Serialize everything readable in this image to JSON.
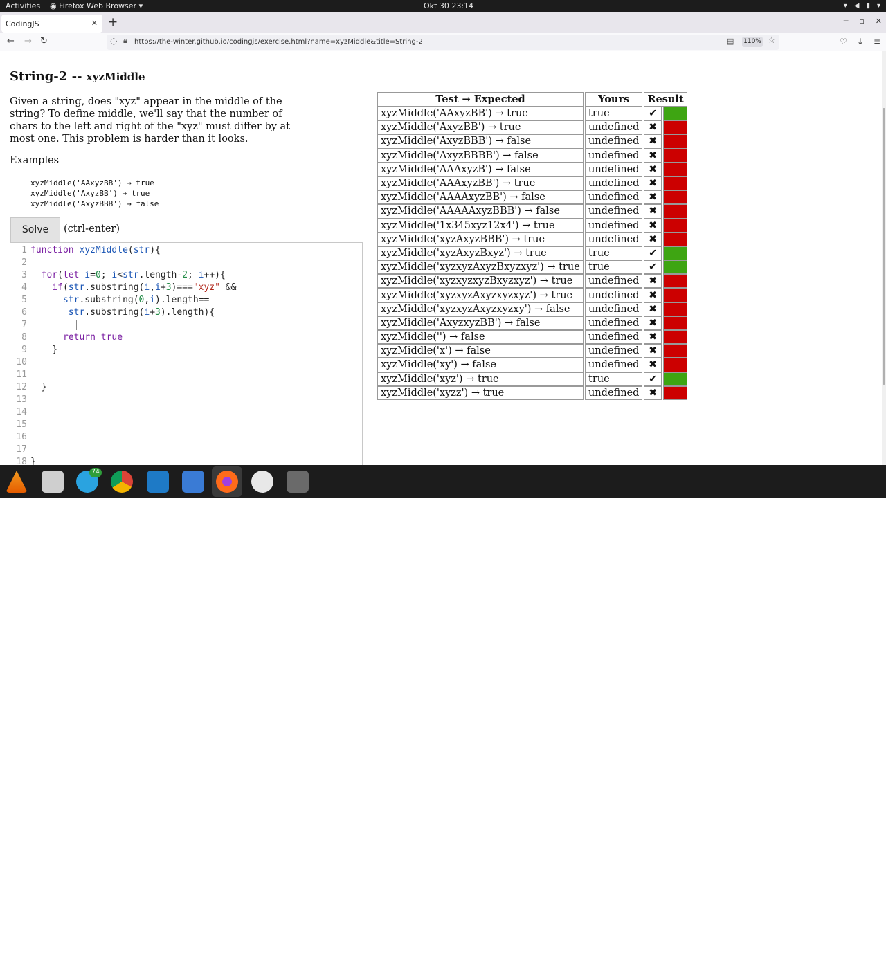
{
  "system": {
    "activities": "Activities",
    "app": "Firefox Web Browser",
    "clock": "Okt 30  23:14"
  },
  "browser": {
    "tab_title": "CodingJS",
    "url": "https://the-winter.github.io/codingjs/exercise.html?name=xyzMiddle&title=String-2",
    "zoom": "110%"
  },
  "page": {
    "title": "String-2 --",
    "title_sub": "xyzMiddle",
    "description": "Given a string, does \"xyz\" appear in the middle of the string? To define middle, we'll say that the number of chars to the left and right of the \"xyz\" must differ by at most one. This problem is harder than it looks.",
    "examples_heading": "Examples",
    "examples": [
      "xyzMiddle('AAxyzBB') → true",
      "xyzMiddle('AxyzBB') → true",
      "xyzMiddle('AxyzBBB') → false"
    ],
    "solve_label": "Solve",
    "solve_hint": "(ctrl-enter)"
  },
  "editor": {
    "line_numbers": [
      "1",
      "2",
      "3",
      "4",
      "5",
      "6",
      "7",
      "8",
      "9",
      "10",
      "11",
      "12",
      "13",
      "14",
      "15",
      "16",
      "17",
      "18"
    ],
    "code_lines": [
      "function xyzMiddle(str){",
      "",
      "  for(let i=0; i<str.length-2; i++){",
      "    if(str.substring(i,i+3)===\"xyz\" &&",
      "      str.substring(0,i).length==",
      "       str.substring(i+3).length){",
      "",
      "      return true",
      "    }",
      "",
      "",
      "  }",
      "",
      "",
      "",
      "",
      "",
      "}"
    ]
  },
  "results": {
    "headers": [
      "Test → Expected",
      "Yours",
      "Result"
    ],
    "rows": [
      {
        "test": "xyzMiddle('AAxyzBB') → true",
        "yours": "true",
        "mark": "✔",
        "status": "pass"
      },
      {
        "test": "xyzMiddle('AxyzBB') → true",
        "yours": "undefined",
        "mark": "✖",
        "status": "fail"
      },
      {
        "test": "xyzMiddle('AxyzBBB') → false",
        "yours": "undefined",
        "mark": "✖",
        "status": "fail"
      },
      {
        "test": "xyzMiddle('AxyzBBBB') → false",
        "yours": "undefined",
        "mark": "✖",
        "status": "fail"
      },
      {
        "test": "xyzMiddle('AAAxyzB') → false",
        "yours": "undefined",
        "mark": "✖",
        "status": "fail"
      },
      {
        "test": "xyzMiddle('AAAxyzBB') → true",
        "yours": "undefined",
        "mark": "✖",
        "status": "fail"
      },
      {
        "test": "xyzMiddle('AAAAxyzBB') → false",
        "yours": "undefined",
        "mark": "✖",
        "status": "fail"
      },
      {
        "test": "xyzMiddle('AAAAAxyzBBB') → false",
        "yours": "undefined",
        "mark": "✖",
        "status": "fail"
      },
      {
        "test": "xyzMiddle('1x345xyz12x4') → true",
        "yours": "undefined",
        "mark": "✖",
        "status": "fail"
      },
      {
        "test": "xyzMiddle('xyzAxyzBBB') → true",
        "yours": "undefined",
        "mark": "✖",
        "status": "fail"
      },
      {
        "test": "xyzMiddle('xyzAxyzBxyz') → true",
        "yours": "true",
        "mark": "✔",
        "status": "pass"
      },
      {
        "test": "xyzMiddle('xyzxyzAxyzBxyzxyz') → true",
        "yours": "true",
        "mark": "✔",
        "status": "pass"
      },
      {
        "test": "xyzMiddle('xyzxyzxyzBxyzxyz') → true",
        "yours": "undefined",
        "mark": "✖",
        "status": "fail"
      },
      {
        "test": "xyzMiddle('xyzxyzAxyzxyzxyz') → true",
        "yours": "undefined",
        "mark": "✖",
        "status": "fail"
      },
      {
        "test": "xyzMiddle('xyzxyzAxyzxyzxy') → false",
        "yours": "undefined",
        "mark": "✖",
        "status": "fail"
      },
      {
        "test": "xyzMiddle('AxyzxyzBB') → false",
        "yours": "undefined",
        "mark": "✖",
        "status": "fail"
      },
      {
        "test": "xyzMiddle('') → false",
        "yours": "undefined",
        "mark": "✖",
        "status": "fail"
      },
      {
        "test": "xyzMiddle('x') → false",
        "yours": "undefined",
        "mark": "✖",
        "status": "fail"
      },
      {
        "test": "xyzMiddle('xy') → false",
        "yours": "undefined",
        "mark": "✖",
        "status": "fail"
      },
      {
        "test": "xyzMiddle('xyz') → true",
        "yours": "true",
        "mark": "✔",
        "status": "pass"
      },
      {
        "test": "xyzMiddle('xyzz') → true",
        "yours": "undefined",
        "mark": "✖",
        "status": "fail"
      }
    ]
  },
  "dock": {
    "telegram_badge": "74"
  },
  "colors": {
    "pass": "#3ea512",
    "fail": "#cc0000"
  }
}
